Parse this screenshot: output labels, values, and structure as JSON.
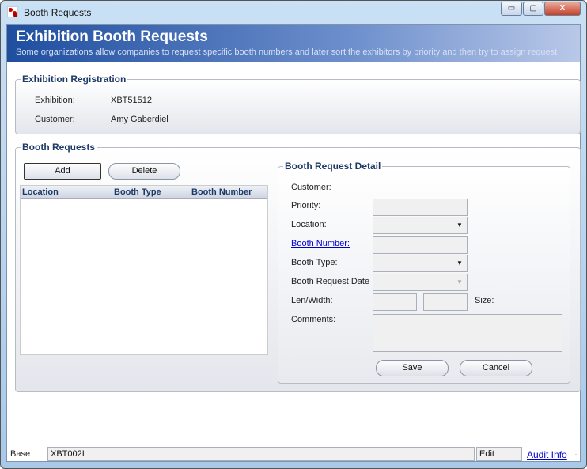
{
  "window": {
    "title": "Booth Requests",
    "minimize": "▭",
    "maximize": "▢",
    "close": "X"
  },
  "banner": {
    "title": "Exhibition Booth Requests",
    "subtitle": "Some organizations allow companies to request specific booth numbers and later sort the exhibitors by priority and then try to assign request"
  },
  "registration": {
    "title": "Exhibition Registration",
    "exhibition_label": "Exhibition:",
    "exhibition_value": "XBT51512",
    "customer_label": "Customer:",
    "customer_value": "Amy Gaberdiel"
  },
  "requests": {
    "title": "Booth Requests",
    "add": "Add",
    "delete": "Delete",
    "columns": [
      "Location",
      "Booth Type",
      "Booth Number"
    ]
  },
  "detail": {
    "title": "Booth Request Detail",
    "customer": "Customer:",
    "priority": "Priority:",
    "location": "Location:",
    "booth_number": "Booth Number:",
    "booth_type": "Booth Type:",
    "request_date": "Booth Request Date",
    "len_width": "Len/Width:",
    "size": "Size:",
    "comments": "Comments:",
    "save": "Save",
    "cancel": "Cancel"
  },
  "status": {
    "base": "Base",
    "code": "XBT002I",
    "mode": "Edit",
    "audit": "Audit Info"
  }
}
